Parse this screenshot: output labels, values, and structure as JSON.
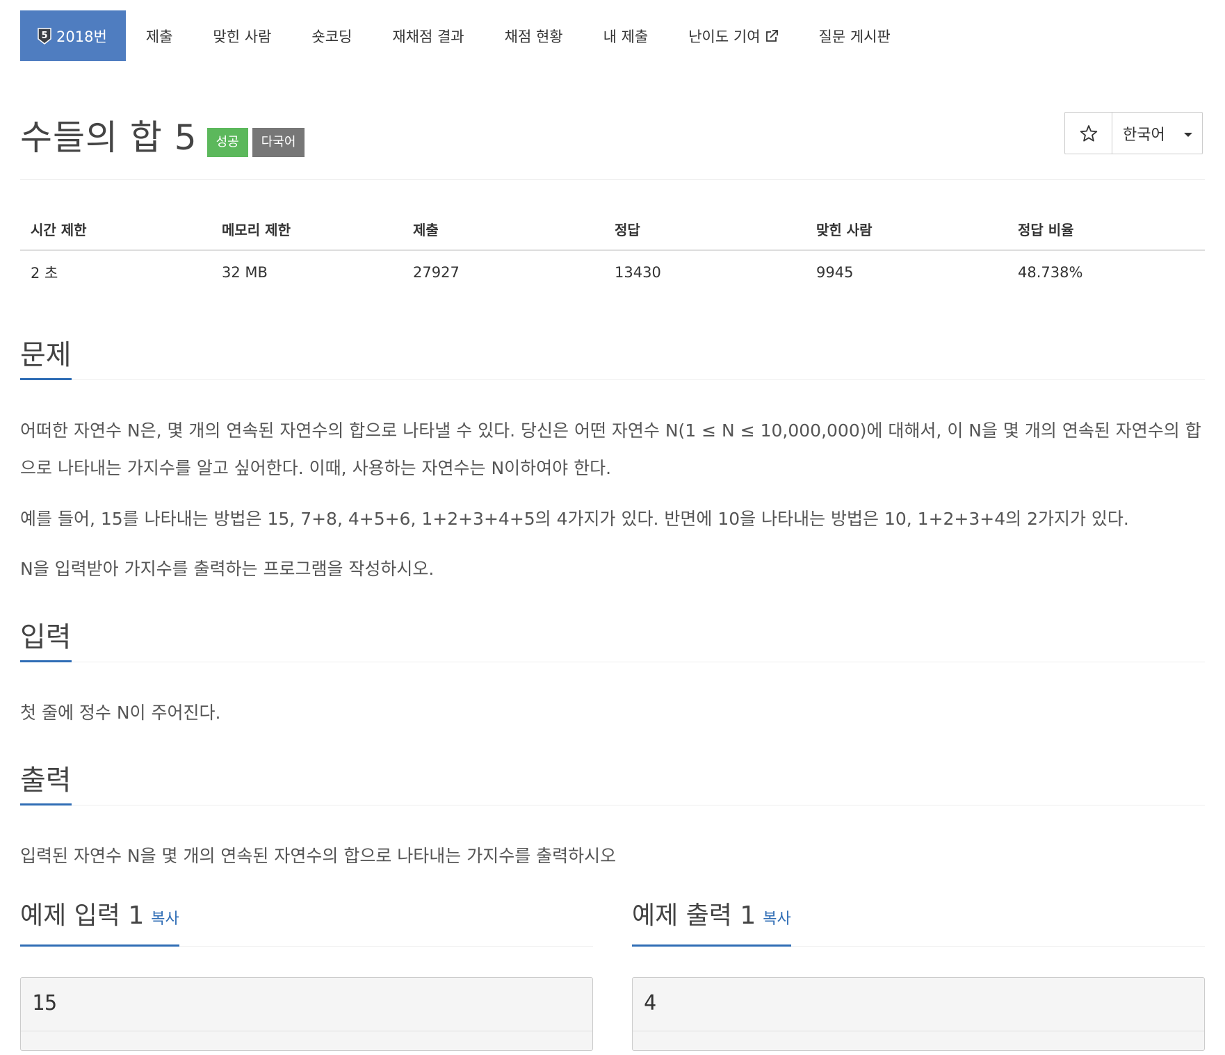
{
  "tabs": {
    "problem_number": "2018번",
    "tier_level": "5",
    "items": [
      "제출",
      "맞힌 사람",
      "숏코딩",
      "재채점 결과",
      "채점 현황",
      "내 제출",
      "난이도 기여",
      "질문 게시판"
    ],
    "active_color": "#4f7dc0"
  },
  "header": {
    "title": "수들의 합 5",
    "labels": [
      "성공",
      "다국어"
    ],
    "language": "한국어"
  },
  "info": {
    "headers": [
      "시간 제한",
      "메모리 제한",
      "제출",
      "정답",
      "맞힌 사람",
      "정답 비율"
    ],
    "values": [
      "2 초",
      "32 MB",
      "27927",
      "13430",
      "9945",
      "48.738%"
    ]
  },
  "sections": {
    "problem": {
      "title": "문제",
      "paragraphs": [
        "어떠한 자연수 N은, 몇 개의 연속된 자연수의 합으로 나타낼 수 있다. 당신은 어떤 자연수 N(1 ≤ N ≤ 10,000,000)에 대해서, 이 N을 몇 개의 연속된 자연수의 합으로 나타내는 가지수를 알고 싶어한다. 이때, 사용하는 자연수는 N이하여야 한다.",
        "예를 들어, 15를 나타내는 방법은 15, 7+8, 4+5+6, 1+2+3+4+5의 4가지가 있다. 반면에 10을 나타내는 방법은 10, 1+2+3+4의 2가지가 있다.",
        "N을 입력받아 가지수를 출력하는 프로그램을 작성하시오."
      ]
    },
    "input": {
      "title": "입력",
      "text": "첫 줄에 정수 N이 주어진다."
    },
    "output": {
      "title": "출력",
      "text": "입력된 자연수 N을 몇 개의 연속된 자연수의 합으로 나타내는 가지수를 출력하시오"
    }
  },
  "samples": {
    "input": {
      "title": "예제 입력 1",
      "copy": "복사",
      "value": "15"
    },
    "output": {
      "title": "예제 출력 1",
      "copy": "복사",
      "value": "4"
    }
  },
  "colors": {
    "accent": "#2f6db5",
    "success": "#5cb85c",
    "multi": "#777777"
  }
}
